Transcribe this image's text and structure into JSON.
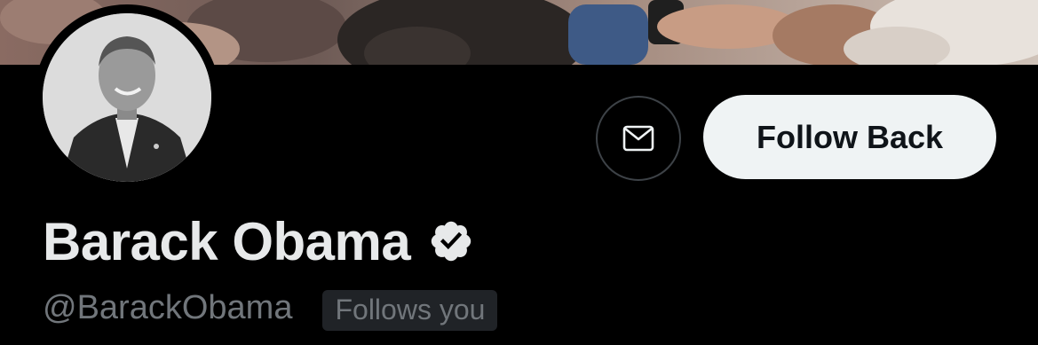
{
  "profile": {
    "display_name": "Barack Obama",
    "handle": "@BarackObama",
    "follows_you_label": "Follows you",
    "verified": true
  },
  "actions": {
    "message_icon": "envelope-icon",
    "follow_back_label": "Follow Back"
  },
  "colors": {
    "background": "#000000",
    "primary_text": "#e7e9ea",
    "secondary_text": "#71767b",
    "button_bg": "#eff3f4",
    "button_text": "#0f1419",
    "badge_bg": "#202327",
    "outline": "#3d4247"
  }
}
